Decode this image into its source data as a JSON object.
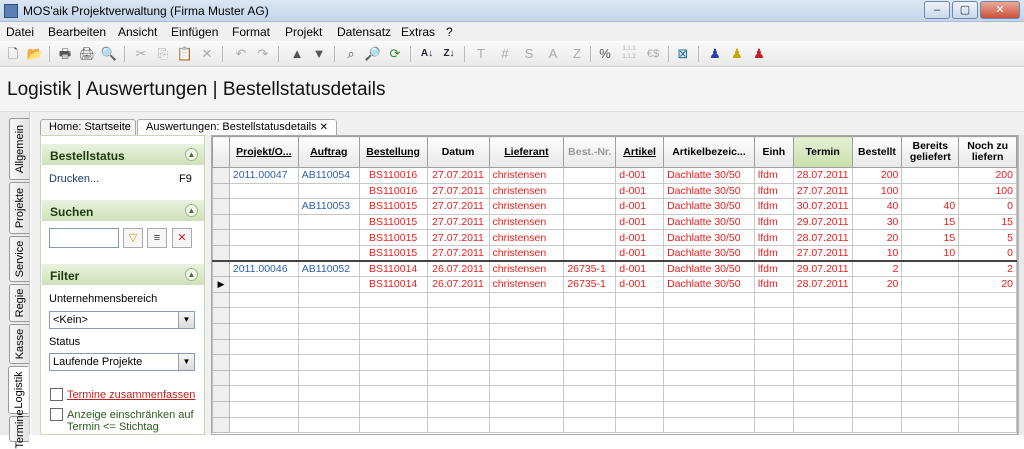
{
  "window": {
    "title": "MOS'aik Projektverwaltung (Firma Muster AG)",
    "min": "–",
    "max": "▢",
    "close": "✕"
  },
  "menu": [
    "Datei",
    "Bearbeiten",
    "Ansicht",
    "Einfügen",
    "Format",
    "Projekt",
    "Datensatz",
    "Extras",
    "?"
  ],
  "toolbar": {
    "letters": [
      "T",
      "#",
      "S",
      "A",
      "Z",
      "%",
      "1.1.1\n1.1.2",
      "€$"
    ]
  },
  "page_title": "Logistik | Auswertungen | Bestellstatusdetails",
  "left_tabs": [
    "Allgemein",
    "Projekte",
    "Service",
    "Regie",
    "Kasse",
    "Logistik",
    "Termine"
  ],
  "doc_tabs": [
    {
      "label": "Home: Startseite"
    },
    {
      "label": "Auswertungen: Bestellstatusdetails",
      "close": "✕"
    }
  ],
  "side": {
    "bestellstatus": {
      "title": "Bestellstatus",
      "print_label": "Drucken...",
      "print_key": "F9"
    },
    "suchen": {
      "title": "Suchen"
    },
    "filter": {
      "title": "Filter",
      "bereich_label": "Unternehmensbereich",
      "bereich_value": "<Kein>",
      "status_label": "Status",
      "status_value": "Laufende Projekte",
      "chk1_label": "Termine zusammenfassen",
      "chk2_label": "Anzeige einschränken auf Termin <= Stichtag"
    }
  },
  "grid": {
    "columns": [
      "Projekt/O...",
      "Auftrag",
      "Bestellung",
      "Datum",
      "Lieferant",
      "Best.-Nr.",
      "Artikel",
      "Artikelbezeic...",
      "Einh",
      "Termin",
      "Bestellt",
      "Bereits geliefert",
      "Noch zu liefern"
    ],
    "rows": [
      {
        "projekt": "2011.00047",
        "auftrag": "AB110054",
        "bestellung": "BS110016",
        "datum": "27.07.2011",
        "lieferant": "christensen",
        "bestnr": "",
        "artikel": "d-001",
        "bez": "Dachlatte 30/50",
        "einh": "lfdm",
        "termin": "28.07.2011",
        "bestellt": "200",
        "geliefert": "",
        "noch": "200"
      },
      {
        "projekt": "",
        "auftrag": "",
        "bestellung": "BS110016",
        "datum": "27.07.2011",
        "lieferant": "christensen",
        "bestnr": "",
        "artikel": "d-001",
        "bez": "Dachlatte 30/50",
        "einh": "lfdm",
        "termin": "27.07.2011",
        "bestellt": "100",
        "geliefert": "",
        "noch": "100"
      },
      {
        "projekt": "",
        "auftrag": "AB110053",
        "bestellung": "BS110015",
        "datum": "27.07.2011",
        "lieferant": "christensen",
        "bestnr": "",
        "artikel": "d-001",
        "bez": "Dachlatte 30/50",
        "einh": "lfdm",
        "termin": "30.07.2011",
        "bestellt": "40",
        "geliefert": "40",
        "noch": "0"
      },
      {
        "projekt": "",
        "auftrag": "",
        "bestellung": "BS110015",
        "datum": "27.07.2011",
        "lieferant": "christensen",
        "bestnr": "",
        "artikel": "d-001",
        "bez": "Dachlatte 30/50",
        "einh": "lfdm",
        "termin": "29.07.2011",
        "bestellt": "30",
        "geliefert": "15",
        "noch": "15"
      },
      {
        "projekt": "",
        "auftrag": "",
        "bestellung": "BS110015",
        "datum": "27.07.2011",
        "lieferant": "christensen",
        "bestnr": "",
        "artikel": "d-001",
        "bez": "Dachlatte 30/50",
        "einh": "lfdm",
        "termin": "28.07.2011",
        "bestellt": "20",
        "geliefert": "15",
        "noch": "5"
      },
      {
        "projekt": "",
        "auftrag": "",
        "bestellung": "BS110015",
        "datum": "27.07.2011",
        "lieferant": "christensen",
        "bestnr": "",
        "artikel": "d-001",
        "bez": "Dachlatte 30/50",
        "einh": "lfdm",
        "termin": "27.07.2011",
        "bestellt": "10",
        "geliefert": "10",
        "noch": "0"
      },
      {
        "projekt": "2011.00046",
        "auftrag": "AB110052",
        "bestellung": "BS110014",
        "datum": "26.07.2011",
        "lieferant": "christensen",
        "bestnr": "26735-1",
        "artikel": "d-001",
        "bez": "Dachlatte 30/50",
        "einh": "lfdm",
        "termin": "29.07.2011",
        "bestellt": "2",
        "geliefert": "",
        "noch": "2"
      },
      {
        "projekt": "",
        "auftrag": "",
        "bestellung": "BS110014",
        "datum": "26.07.2011",
        "lieferant": "christensen",
        "bestnr": "26735-1",
        "artikel": "d-001",
        "bez": "Dachlatte 30/50",
        "einh": "lfdm",
        "termin": "28.07.2011",
        "bestellt": "20",
        "geliefert": "",
        "noch": "20"
      }
    ],
    "empty_rows": 9,
    "current_row_marker": "▶"
  },
  "colors": {
    "data_text": "#e81c1c",
    "link_text": "#2b5fae",
    "panel_header": "#cfe1b8"
  }
}
